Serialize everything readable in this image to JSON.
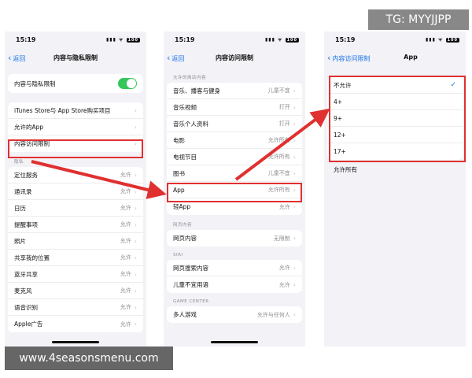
{
  "watermark_tag": "TG: MYYJJPP",
  "watermark_url": "www.4seasonsmenu.com",
  "status": {
    "time": "15:19",
    "battery": "100",
    "signal": "▮▮▮ ᯤ"
  },
  "screen1": {
    "back": "返回",
    "title": "内容与隐私限制",
    "toggle_label": "内容与隐私限制",
    "group1": [
      {
        "label": "iTunes Store与 App Store购买项目"
      },
      {
        "label": "允许的App"
      },
      {
        "label": "内容访问限制"
      }
    ],
    "section": "隐私",
    "group2": [
      {
        "label": "定位服务",
        "value": "允许"
      },
      {
        "label": "通讯录",
        "value": "允许"
      },
      {
        "label": "日历",
        "value": "允许"
      },
      {
        "label": "提醒事项",
        "value": "允许"
      },
      {
        "label": "照片",
        "value": "允许"
      },
      {
        "label": "共享我的位置",
        "value": "允许"
      },
      {
        "label": "蓝牙共享",
        "value": "允许"
      },
      {
        "label": "麦克风",
        "value": "允许"
      },
      {
        "label": "语音识别",
        "value": "允许"
      },
      {
        "label": "Apple广告",
        "value": "允许"
      }
    ]
  },
  "screen2": {
    "back": "返回",
    "title": "内容访问限制",
    "section1": "允许的商店内容",
    "group1": [
      {
        "label": "音乐、播客与健身",
        "value": "儿童不宜"
      },
      {
        "label": "音乐视频",
        "value": "打开"
      },
      {
        "label": "音乐个人资料",
        "value": "打开"
      },
      {
        "label": "电影",
        "value": "允许所有"
      },
      {
        "label": "电视节目",
        "value": "允许所有"
      },
      {
        "label": "图书",
        "value": "儿童不宜"
      },
      {
        "label": "App",
        "value": "允许所有"
      },
      {
        "label": "轻App",
        "value": "允许"
      }
    ],
    "section2": "网页内容",
    "group2": [
      {
        "label": "网页内容",
        "value": "无限制"
      }
    ],
    "section3": "SIRI",
    "group3": [
      {
        "label": "网页搜索内容",
        "value": "允许"
      },
      {
        "label": "儿童不宜用语",
        "value": "允许"
      }
    ],
    "section4": "GAME CENTER",
    "group4": [
      {
        "label": "多人游戏",
        "value": "允许与任何人"
      }
    ]
  },
  "screen3": {
    "back": "内容访问限制",
    "title": "App",
    "options": [
      {
        "label": "不允许",
        "checked": "✓"
      },
      {
        "label": "4+",
        "checked": ""
      },
      {
        "label": "9+",
        "checked": ""
      },
      {
        "label": "12+",
        "checked": ""
      },
      {
        "label": "17+",
        "checked": ""
      }
    ],
    "extra": "允许所有"
  },
  "accent_colors": {
    "link": "#1a73e8",
    "toggle": "#34c759",
    "highlight": "#e03030"
  },
  "icons": {
    "back": "chevron-left-icon",
    "row": "chevron-right-icon",
    "selected": "checkmark-icon"
  }
}
